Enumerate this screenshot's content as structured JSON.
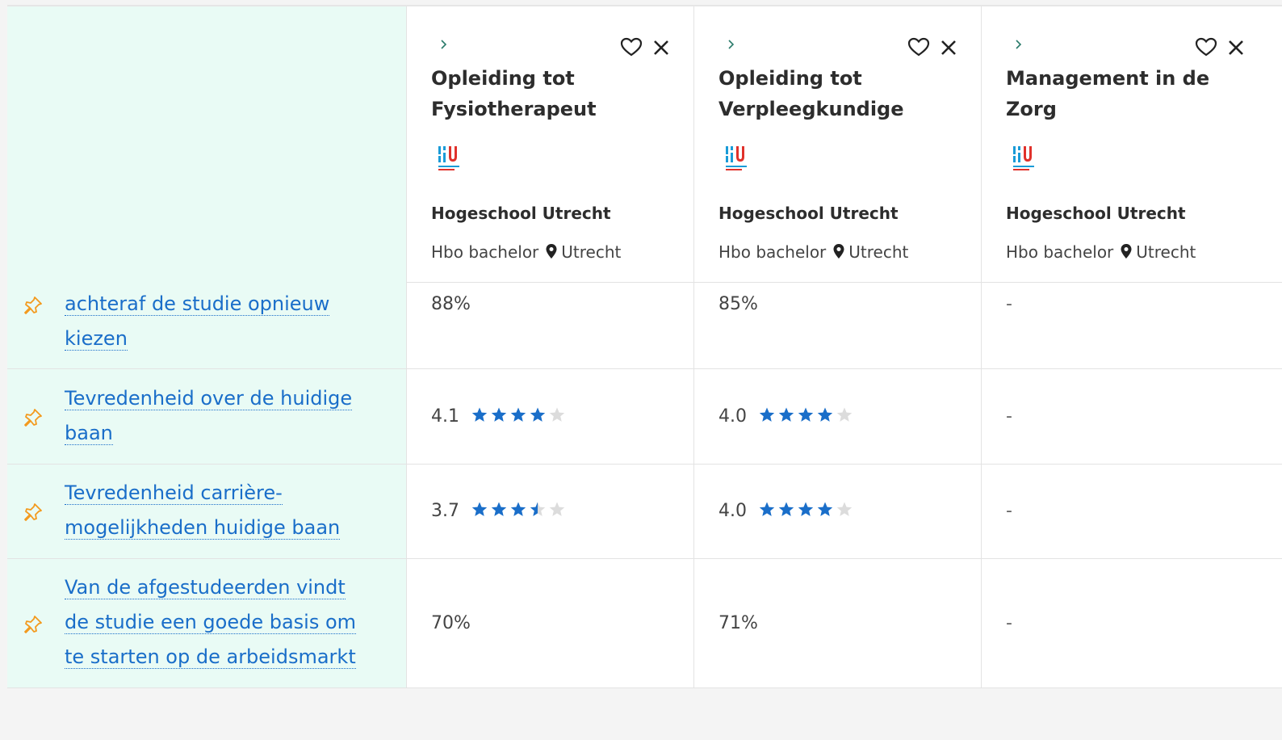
{
  "programs": [
    {
      "title_line1": "Opleiding tot",
      "title_line2": "Fysiotherapeut",
      "school": "Hogeschool Utrecht",
      "level": "Hbo bachelor",
      "city": "Utrecht",
      "values": [
        "88%",
        "4.1",
        "3.7",
        "70%"
      ]
    },
    {
      "title_line1": "Opleiding tot",
      "title_line2": "Verpleegkundige",
      "school": "Hogeschool Utrecht",
      "level": "Hbo bachelor",
      "city": "Utrecht",
      "values": [
        "85%",
        "4.0",
        "4.0",
        "71%"
      ]
    },
    {
      "title_line1": "Management in de",
      "title_line2": "Zorg",
      "school": "Hogeschool Utrecht",
      "level": "Hbo bachelor",
      "city": "Utrecht",
      "values": [
        "-",
        "-",
        "-",
        "-"
      ]
    }
  ],
  "rows": [
    {
      "label_line1": "achteraf de studie opnieuw",
      "label_line2": "kiezen"
    },
    {
      "label_line1": "Tevredenheid over de huidige",
      "label_line2": "baan"
    },
    {
      "label_line1": "Tevredenheid carrière-",
      "label_line2": "mogelijkheden huidige baan"
    },
    {
      "label_line1": "Van de afgestudeerden vindt",
      "label_line2": "de studie een goede basis om",
      "label_line3": "te starten op de arbeidsmarkt"
    }
  ],
  "ratings": {
    "scale_max": 5,
    "p0_row1": 4.1,
    "p0_row2": 3.7,
    "p1_row1": 4.0,
    "p1_row2": 4.0
  },
  "colors": {
    "label_bg": "#e9fbf5",
    "link": "#1a6ec9",
    "star": "#1a6ec9",
    "star_empty": "#dcdcdc",
    "pin": "#f39a1e",
    "logo_blue": "#1a9bd7",
    "logo_red": "#e0312b"
  },
  "icons": {
    "pin": "pin-icon",
    "heart": "heart-icon",
    "close": "close-icon",
    "chevron": "chevron-right-icon",
    "location": "location-pin-icon"
  }
}
